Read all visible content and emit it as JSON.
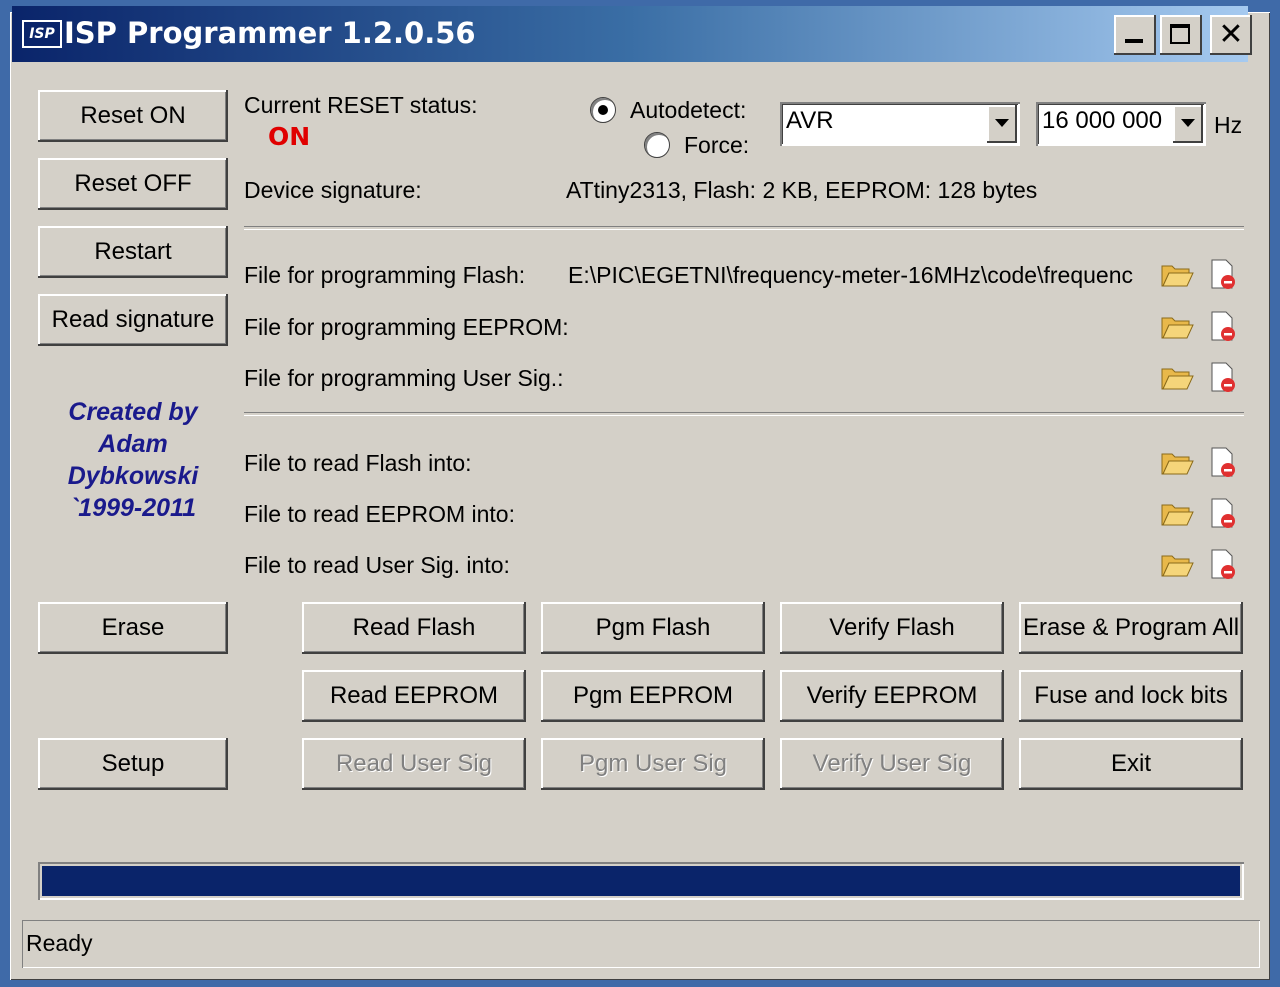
{
  "window": {
    "title": "ISP Programmer 1.2.0.56",
    "app_icon_text": "ISP",
    "close_glyph": "✕"
  },
  "left_buttons": {
    "reset_on": "Reset ON",
    "reset_off": "Reset OFF",
    "restart": "Restart",
    "read_signature": "Read signature",
    "erase": "Erase",
    "setup": "Setup"
  },
  "credit": [
    "Created by",
    "Adam",
    "Dybkowski",
    "`1999-2011"
  ],
  "reset_status": {
    "label": "Current RESET status:",
    "value": "ON",
    "value_color": "#e00000"
  },
  "device_type": {
    "autodetect_label": "Autodetect:",
    "force_label": "Force:",
    "selected_mode": "Autodetect",
    "device": "AVR"
  },
  "frequency": {
    "value": "16 000 000",
    "unit": "Hz"
  },
  "signature": {
    "label": "Device signature:",
    "value": "ATtiny2313, Flash: 2 KB, EEPROM: 128 bytes"
  },
  "programming_files": [
    {
      "label": "File for programming Flash:",
      "path": "E:\\PIC\\EGETNI\\frequency-meter-16MHz\\code\\frequenc"
    },
    {
      "label": "File for programming EEPROM:",
      "path": ""
    },
    {
      "label": "File for programming User Sig.:",
      "path": ""
    }
  ],
  "read_files": [
    {
      "label": "File to read Flash into:",
      "path": ""
    },
    {
      "label": "File to read EEPROM into:",
      "path": ""
    },
    {
      "label": "File to read User Sig. into:",
      "path": ""
    }
  ],
  "action_buttons": {
    "read_flash": "Read Flash",
    "pgm_flash": "Pgm Flash",
    "verify_flash": "Verify Flash",
    "erase_program_all": "Erase & Program All",
    "read_eeprom": "Read EEPROM",
    "pgm_eeprom": "Pgm EEPROM",
    "verify_eeprom": "Verify EEPROM",
    "fuse_lock": "Fuse and lock bits",
    "read_user_sig": "Read User Sig",
    "pgm_user_sig": "Pgm User Sig",
    "verify_user_sig": "Verify User Sig",
    "exit": "Exit"
  },
  "progress": {
    "fraction": 1.0,
    "color": "#0a246a"
  },
  "status_bar": {
    "text": "Ready"
  },
  "icons": {
    "open": "folder-open-icon",
    "clear": "clear-file-icon"
  }
}
